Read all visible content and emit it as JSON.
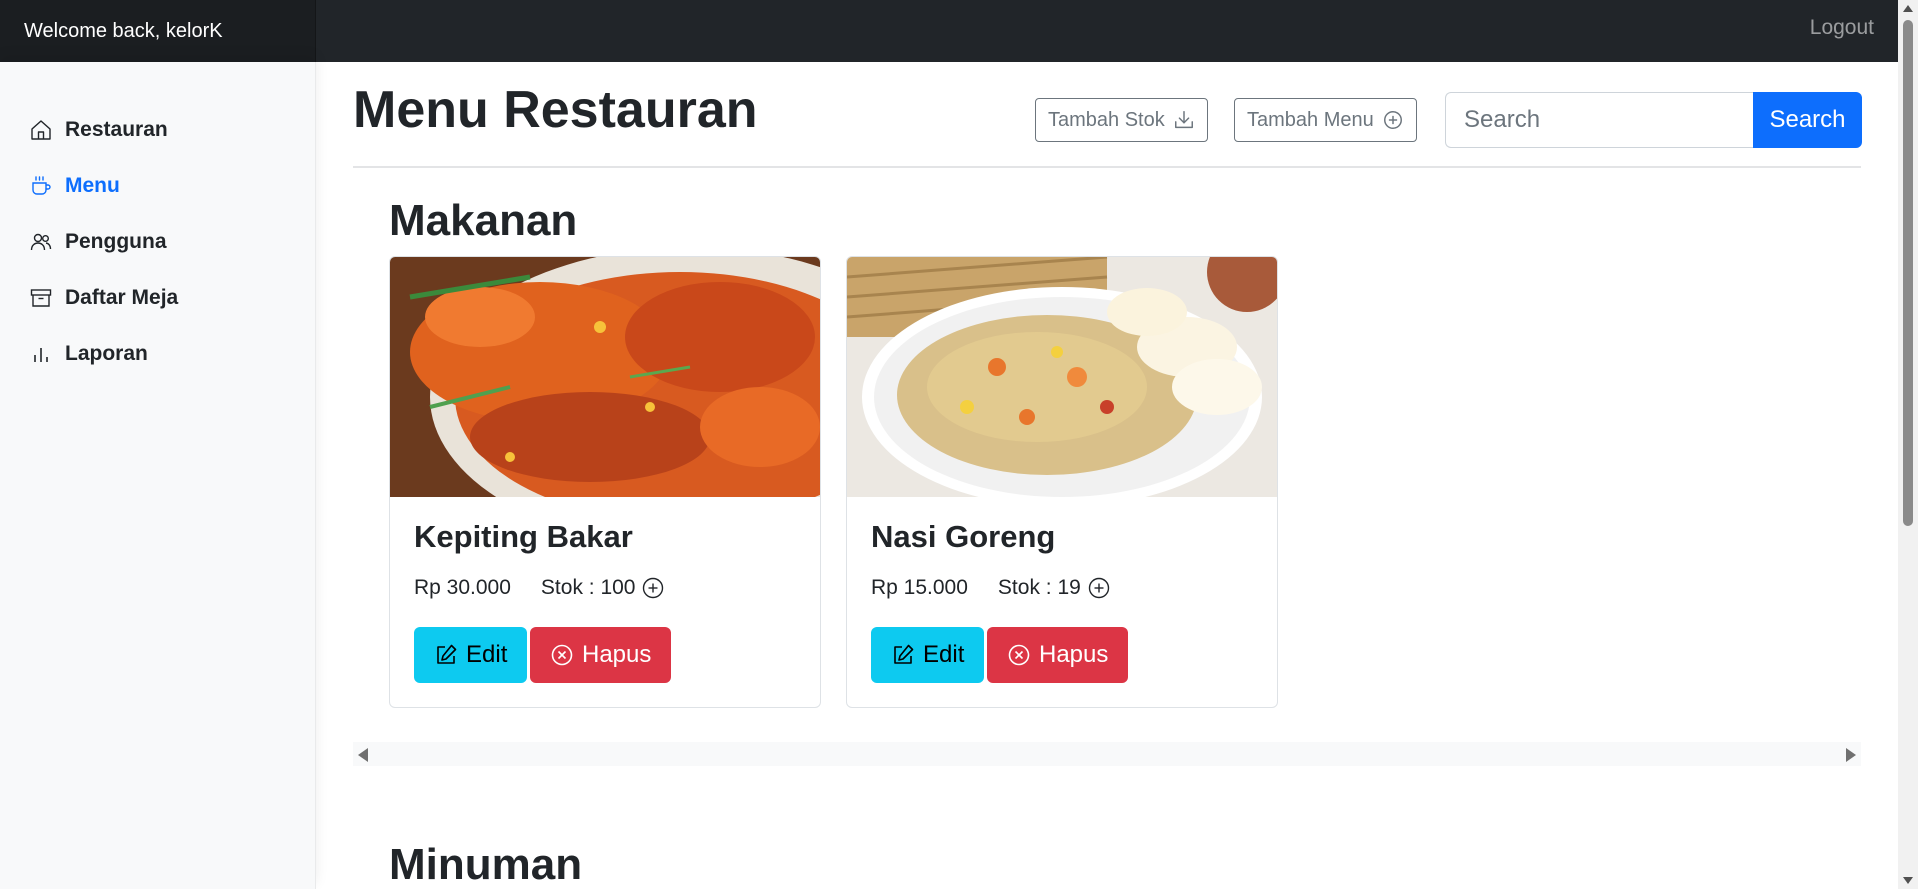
{
  "header": {
    "welcome": "Welcome back, kelorK",
    "logout_label": "Logout"
  },
  "sidebar": {
    "items": [
      {
        "label": "Restauran",
        "icon": "house-icon",
        "active": false
      },
      {
        "label": "Menu",
        "icon": "cup-icon",
        "active": true
      },
      {
        "label": "Pengguna",
        "icon": "people-icon",
        "active": false
      },
      {
        "label": "Daftar Meja",
        "icon": "archive-icon",
        "active": false
      },
      {
        "label": "Laporan",
        "icon": "bar-chart-icon",
        "active": false
      }
    ]
  },
  "main": {
    "title": "Menu Restauran",
    "tambah_stok_label": "Tambah Stok",
    "tambah_menu_label": "Tambah Menu",
    "search": {
      "placeholder": "Search",
      "value": "",
      "button_label": "Search"
    },
    "sections": [
      {
        "title": "Makanan",
        "items": [
          {
            "name": "Kepiting Bakar",
            "price": "Rp 30.000",
            "stock_label": "Stok : 100",
            "image": "grilled-crab-photo",
            "edit_label": "Edit",
            "delete_label": "Hapus"
          },
          {
            "name": "Nasi Goreng",
            "price": "Rp 15.000",
            "stock_label": "Stok : 19",
            "image": "fried-rice-photo",
            "edit_label": "Edit",
            "delete_label": "Hapus"
          }
        ]
      },
      {
        "title": "Minuman",
        "items": []
      }
    ]
  },
  "colors": {
    "topbar": "#212529",
    "sidebar": "#f8f9fa",
    "primary": "#0d6efd",
    "info": "#0dcaf0",
    "danger": "#dc3545",
    "outline": "#6c757d"
  }
}
